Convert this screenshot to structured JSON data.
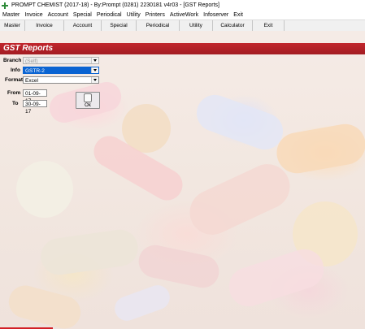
{
  "window": {
    "title": "PROMPT CHEMIST (2017-18) - By:Prompt (0281) 2230181 v4r03 - [GST Reports]",
    "app_icon": "plus-cross-icon",
    "accent_color": "#2e8b3a"
  },
  "menu": [
    "Master",
    "Invoice",
    "Account",
    "Special",
    "Periodical",
    "Utility",
    "Printers",
    "ActiveWork",
    "Infoserver",
    "Exit"
  ],
  "toolbar": [
    "Master",
    "Invoice",
    "Account",
    "Special",
    "Periodical",
    "Utility",
    "Calculator",
    "Exit"
  ],
  "report": {
    "header_title": "GST Reports",
    "header_color": "#b8222a",
    "branch_label": "Branch",
    "branch_value": "(Self)",
    "info_label": "Info",
    "info_value": "GSTR-2",
    "format_label": "Format",
    "format_value": "Excel",
    "from_label": "From",
    "from_value": "01-09-17",
    "to_label": "To",
    "to_value": "30-09-17",
    "ok_label": "Ok"
  },
  "status": {
    "progress_color": "#d21f26"
  }
}
